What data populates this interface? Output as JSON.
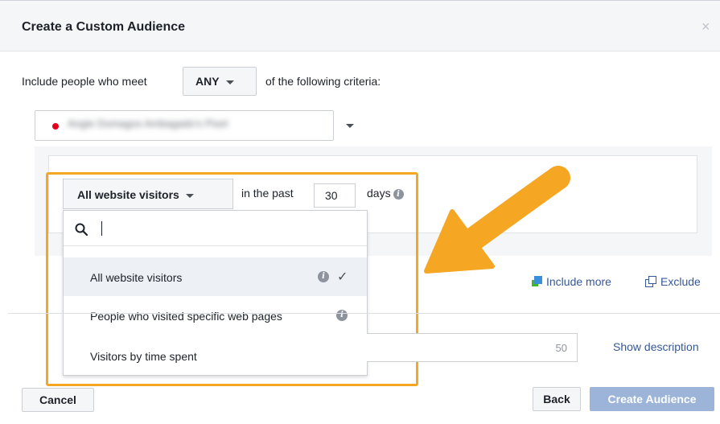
{
  "dialog": {
    "title": "Create a Custom Audience",
    "close_glyph": "×"
  },
  "criteria": {
    "prefix": "Include people who meet",
    "match_value": "ANY",
    "suffix": "of the following criteria:"
  },
  "pixel": {
    "name": "Angie Domagos Ambagado's Pixel",
    "status_color": "#e0001b"
  },
  "rule": {
    "audience_type": "All website visitors",
    "in_the_past_label": "in the past",
    "days_value": "30",
    "days_label": "days"
  },
  "dropdown": {
    "options": [
      {
        "label": "All website visitors",
        "selected": true
      },
      {
        "label": "People who visited specific web pages",
        "selected": false
      },
      {
        "label": "Visitors by time spent",
        "selected": false
      }
    ]
  },
  "actions": {
    "include_more": "Include more",
    "exclude": "Exclude"
  },
  "audience_name": {
    "char_limit": "50",
    "show_description": "Show description"
  },
  "footer": {
    "cancel": "Cancel",
    "back": "Back",
    "create": "Create Audience"
  },
  "colors": {
    "highlight": "#f5a623",
    "link": "#365899",
    "primary_disabled": "#9cb4d8"
  },
  "icons": {
    "search": "search-icon",
    "info": "info-icon",
    "check": "checkmark-icon",
    "caret": "caret-down-icon",
    "close": "close-icon"
  }
}
